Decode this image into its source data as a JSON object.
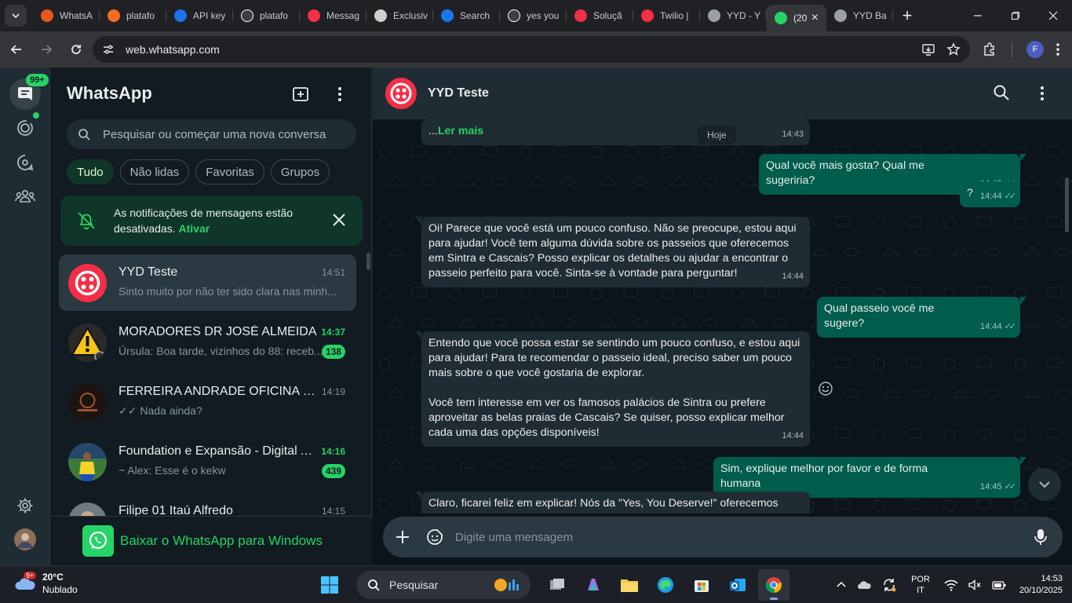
{
  "browser": {
    "tabs": [
      {
        "title": "WhatsA",
        "icon": "alert-icon",
        "color": "#e8581c"
      },
      {
        "title": "platafo",
        "icon": "flow-icon",
        "color": "#f36d21"
      },
      {
        "title": "API key",
        "icon": "api-icon",
        "color": "#1a73e8"
      },
      {
        "title": "platafo",
        "icon": "github-icon",
        "color": "#ffffff"
      },
      {
        "title": "Messag",
        "icon": "twilio-icon",
        "color": "#f22f46"
      },
      {
        "title": "Exclusiv",
        "icon": "doc-icon",
        "color": "#cfcfcf"
      },
      {
        "title": "Search",
        "icon": "facebook-icon",
        "color": "#1877f2"
      },
      {
        "title": "yes you",
        "icon": "google-icon",
        "color": "#ffffff"
      },
      {
        "title": "Soluçã",
        "icon": "twilio-icon",
        "color": "#f22f46"
      },
      {
        "title": "Twilio |",
        "icon": "twilio-icon",
        "color": "#f22f46"
      },
      {
        "title": "YYD - Y",
        "icon": "globe-icon",
        "color": "#9aa0a6"
      },
      {
        "title": "(20",
        "icon": "whatsapp-icon",
        "color": "#25d366",
        "active": true
      },
      {
        "title": "YYD Ba",
        "icon": "globe-icon",
        "color": "#9aa0a6"
      }
    ],
    "url": "web.whatsapp.com",
    "profile_initial": "F"
  },
  "whatsapp": {
    "rail": {
      "badge": "99+"
    },
    "title": "WhatsApp",
    "search_placeholder": "Pesquisar ou começar uma nova conversa",
    "filters": [
      "Tudo",
      "Não lidas",
      "Favoritas",
      "Grupos"
    ],
    "active_filter": "Tudo",
    "notification": {
      "text": "As notificações de mensagens estão desativadas.",
      "action": "Ativar"
    },
    "chats": [
      {
        "name": "YYD Teste",
        "time": "14:51",
        "preview": "Sinto muito por não ter sido clara nas minh...",
        "badge": "",
        "selected": true,
        "avatar": "twilio"
      },
      {
        "name": "MORADORES DR JOSÉ ALMEIDA",
        "time": "14:37",
        "preview": "Úrsula: Boa tarde, vizinhos do 88: receb...",
        "badge": "138",
        "unread": true,
        "avatar": "warning"
      },
      {
        "name": "FERREIRA ANDRADE OFICINA ESP...",
        "time": "14:19",
        "preview": "✓✓ Nada ainda?",
        "badge": "",
        "avatar": "shop"
      },
      {
        "name": "Foundation e Expansão - Digital A...",
        "time": "14:16",
        "preview": "~ Alex: Esse é o kekw",
        "badge": "439",
        "unread": true,
        "avatar": "football"
      },
      {
        "name": "Filipe 01 Itaú Alfredo",
        "time": "14:15",
        "preview": "",
        "badge": "",
        "avatar": "person"
      }
    ],
    "download_banner": "Baixar o WhatsApp para Windows",
    "conversation": {
      "name": "YYD Teste",
      "date_pill": "Hoje",
      "composer_placeholder": "Digite uma mensagem",
      "messages": [
        {
          "dir": "in",
          "prefix": "...",
          "link": "Ler mais",
          "time": "14:43"
        },
        {
          "dir": "out",
          "text": "Qual você mais gosta? Qual me sugeriria?",
          "time": "14:43"
        },
        {
          "dir": "out",
          "text": "?",
          "time": "14:44"
        },
        {
          "dir": "in",
          "text": "Oi! Parece que você está um pouco confuso. Não se preocupe, estou aqui para ajudar! Você tem alguma dúvida sobre os passeios que oferecemos em Sintra e Cascais? Posso explicar os detalhes ou ajudar a encontrar o passeio perfeito para você. Sinta-se à vontade para perguntar!",
          "time": "14:44"
        },
        {
          "dir": "out",
          "text": "Qual passeio você me sugere?",
          "time": "14:44"
        },
        {
          "dir": "in",
          "text": "Entendo que você possa estar se sentindo um pouco confuso, e estou aqui para ajudar! Para te recomendar o passeio ideal, preciso saber um pouco mais sobre o que você gostaria de explorar.\n\nVocê tem interesse em ver os famosos palácios de Sintra ou prefere aproveitar as belas praias de Cascais? Se quiser, posso explicar melhor cada uma das opções disponíveis!",
          "time": "14:44"
        },
        {
          "dir": "out",
          "text": "Sim, explique melhor por favor e de forma humana",
          "time": "14:45"
        },
        {
          "dir": "in",
          "text": "Claro, ficarei feliz em explicar! Nós da \"Yes, You Deserve!\" oferecemos tours",
          "time": ""
        }
      ]
    }
  },
  "taskbar": {
    "weather_temp": "20°C",
    "weather_desc": "Nublado",
    "weather_badge": "9+",
    "search_label": "Pesquisar",
    "lang_top": "POR",
    "lang_bottom": "IT",
    "time": "14:53",
    "date": "20/10/2025"
  }
}
